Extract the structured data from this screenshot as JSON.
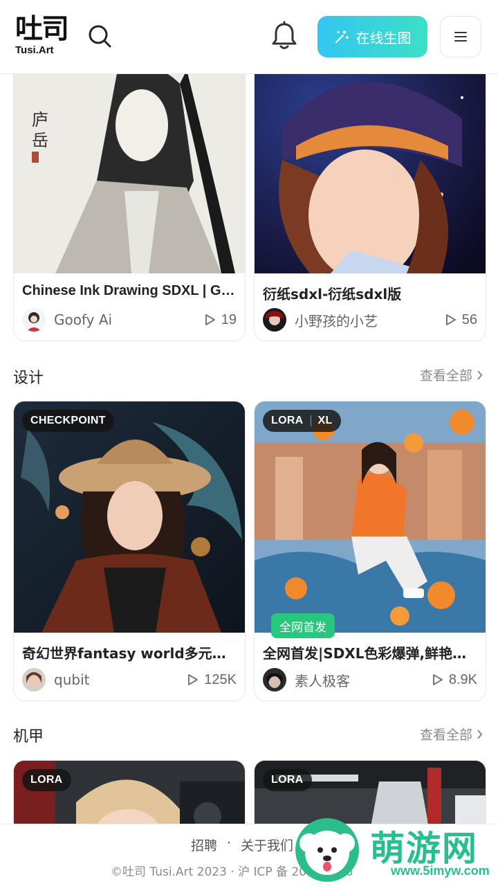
{
  "header": {
    "logo_mark": "吐司",
    "logo_sub": "Tusi.Art",
    "generate_label": "在线生图",
    "icons": [
      "search-icon",
      "bell-icon",
      "sparkle-icon",
      "hamburger-menu-icon"
    ]
  },
  "top_cards": [
    {
      "title": "Chinese Ink Drawing SDXL | Go...",
      "author": "Goofy Ai",
      "plays": "19"
    },
    {
      "title": "衍纸sdxl-衍纸sdxl版",
      "author": "小野孩的小艺",
      "plays": "56"
    }
  ],
  "sections": [
    {
      "title": "设计",
      "view_all": "查看全部",
      "cards": [
        {
          "badge": "CHECKPOINT",
          "title": "奇幻世界fantasy world多元混...",
          "author": "qubit",
          "plays": "125K"
        },
        {
          "badge": "LORA",
          "badge2": "XL",
          "tag": "全网首发",
          "title": "全网首发|SDXL色彩爆弹,鲜艳是...",
          "author": "素人极客",
          "plays": "8.9K"
        }
      ]
    },
    {
      "title": "机甲",
      "view_all": "查看全部",
      "cards": [
        {
          "badge": "LORA"
        },
        {
          "badge": "LORA"
        }
      ]
    }
  ],
  "footer": {
    "link_jobs": "招聘",
    "link_about": "关于我们",
    "sep": "·",
    "copyright": "©吐司 Tusi.Art 2023 · 沪 ICP 备 20…9 号-6"
  },
  "watermark": {
    "text": "萌游网",
    "url": "www.5imyw.com"
  },
  "colors": {
    "accent_gradient_start": "#34c6f2",
    "accent_gradient_end": "#3ddfc7",
    "badge_green": "#27c77d",
    "watermark_green": "#27bf8d"
  }
}
